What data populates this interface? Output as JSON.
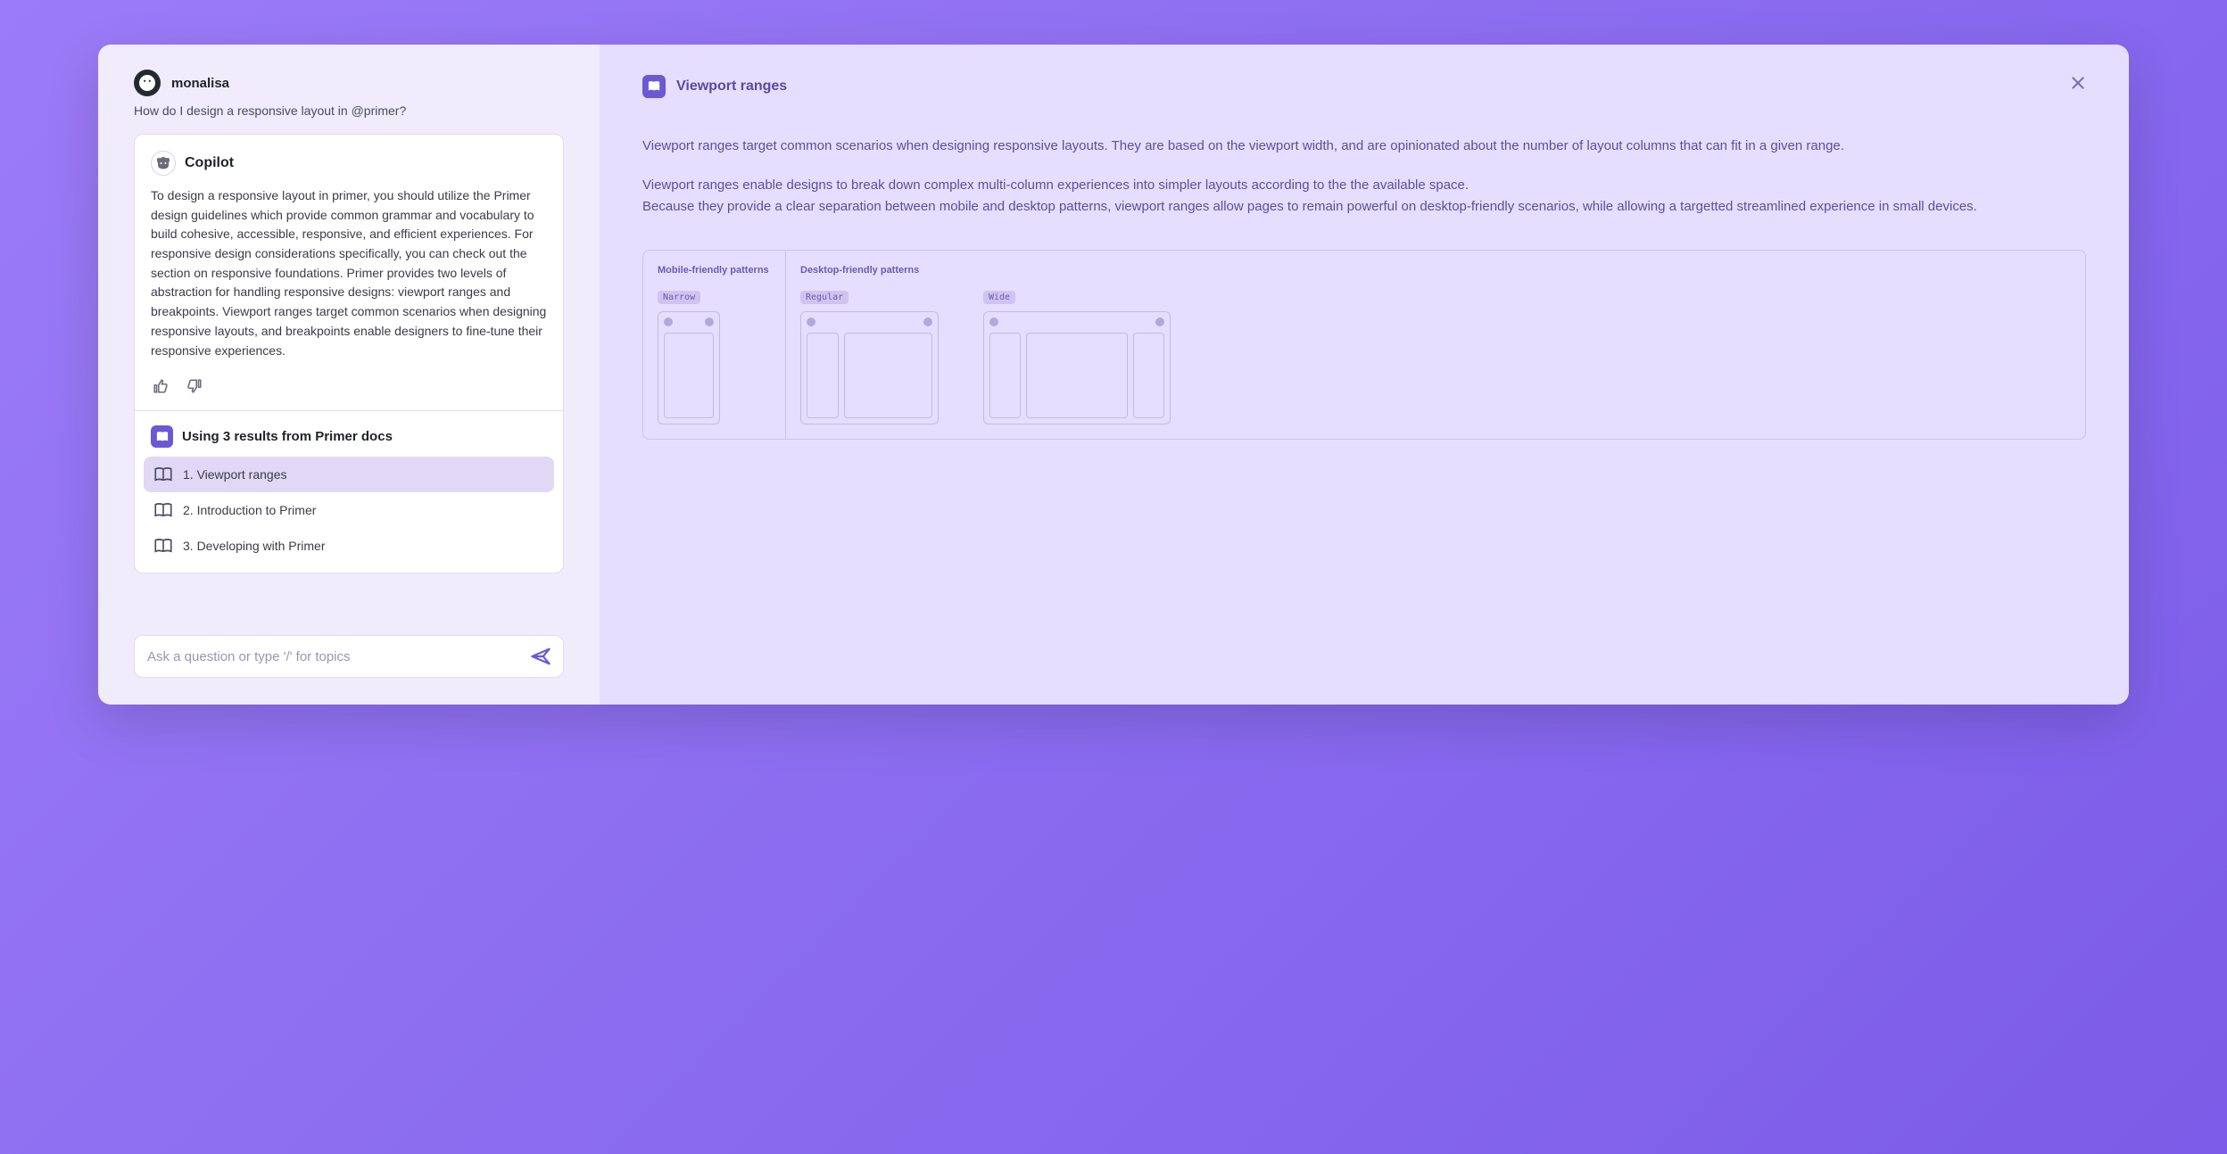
{
  "user": {
    "name": "monalisa",
    "question": "How do I design a responsive layout in @primer?"
  },
  "copilot": {
    "title": "Copilot",
    "answer": "To design a responsive layout in primer, you should utilize the Primer design guidelines which provide common grammar and vocabulary to build cohesive, accessible, responsive, and efficient experiences. For responsive design considerations specifically, you can check out the section on responsive foundations. Primer provides two levels of abstraction for handling responsive designs: viewport ranges and breakpoints. Viewport ranges target common scenarios when designing responsive layouts, and breakpoints enable designers to fine-tune their responsive experiences."
  },
  "results": {
    "heading": "Using 3 results from Primer docs",
    "items": [
      {
        "label": "1. Viewport ranges",
        "active": true
      },
      {
        "label": "2. Introduction to Primer",
        "active": false
      },
      {
        "label": "3. Developing with Primer",
        "active": false
      }
    ]
  },
  "input": {
    "placeholder": "Ask a question or type '/' for topics"
  },
  "detail": {
    "title": "Viewport ranges",
    "p1": "Viewport ranges target common scenarios when designing responsive layouts. They are based on the viewport width, and are opinionated about the number of layout columns that can fit in a given range.",
    "p2": "Viewport ranges enable designs to break down complex multi-column experiences into simpler layouts according to the the available space.",
    "p3": "Because they provide a clear separation between mobile and desktop patterns, viewport ranges allow pages to remain powerful on desktop-friendly scenarios, while allowing a targetted streamlined experience in small devices.",
    "diagram": {
      "mobile_label": "Mobile-friendly patterns",
      "desktop_label": "Desktop-friendly patterns",
      "narrow": "Narrow",
      "regular": "Regular",
      "wide": "Wide"
    }
  }
}
